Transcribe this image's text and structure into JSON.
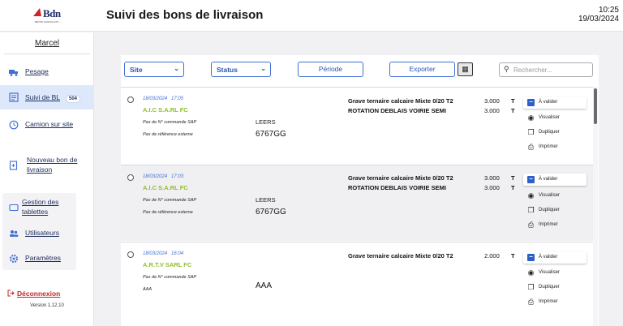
{
  "header": {
    "logo_text": "Bdn",
    "logo_tagline": "BÉTON GRANULATS ...",
    "title": "Suivi des bons de livraison",
    "time": "10:25",
    "date": "19/03/2024"
  },
  "sidebar": {
    "user": "Marcel",
    "items": [
      {
        "label": "Pesage",
        "icon": "truck-icon"
      },
      {
        "label": "Suivi de BL",
        "icon": "list-icon",
        "badge": "504"
      },
      {
        "label": "Camion sur site",
        "icon": "clock-icon"
      },
      {
        "label": "Nouveau bon de livraison",
        "label_line1": "Nouveau bon de",
        "label_line2": "livraison",
        "icon": "new-document-icon"
      }
    ],
    "admin_items": [
      {
        "label": "Gestion des tablettes",
        "label_line1": "Gestion des",
        "label_line2": "tablettes",
        "icon": "tablet-icon"
      },
      {
        "label": "Utilisateurs",
        "icon": "users-icon"
      },
      {
        "label": "Paramètres",
        "icon": "gear-icon"
      }
    ],
    "logout": "Déconnexion",
    "version": "Version 1.12.10"
  },
  "toolbar": {
    "site": "Site",
    "status": "Status",
    "periode": "Période",
    "export": "Exporter",
    "search_placeholder": "Rechercher..."
  },
  "rows": [
    {
      "date": "18/03/2024",
      "time": "17:05",
      "client": "A.I.C S.A.RL FC",
      "commande": "Pas de N° commande SAP",
      "reference": "Pas de référence externe",
      "site": "LEERS",
      "plate": "6767GG",
      "products": [
        {
          "name": "Grave ternaire calcaire Mixte 0/20 T2",
          "qty": "3.000",
          "unit": "T"
        },
        {
          "name": "ROTATION DEBLAIS VOIRIE SEMI",
          "qty": "3.000",
          "unit": "T"
        }
      ],
      "status": "À valider"
    },
    {
      "date": "18/03/2024",
      "time": "17:03",
      "client": "A.I.C S.A.RL FC",
      "commande": "Pas de N° commande SAP",
      "reference": "Pas de référence externe",
      "site": "LEERS",
      "plate": "6767GG",
      "products": [
        {
          "name": "Grave ternaire calcaire Mixte 0/20 T2",
          "qty": "3.000",
          "unit": "T"
        },
        {
          "name": "ROTATION DEBLAIS VOIRIE SEMI",
          "qty": "3.000",
          "unit": "T"
        }
      ],
      "status": "À valider"
    },
    {
      "date": "18/03/2024",
      "time": "16:04",
      "client": "A.R.T.V SARL FC",
      "commande": "Pas de N° commande SAP",
      "reference": "AAA",
      "site": "",
      "plate": "AAA",
      "products": [
        {
          "name": "Grave ternaire calcaire Mixte 0/20 T2",
          "qty": "2.000",
          "unit": "T"
        }
      ],
      "status": "À valider"
    }
  ],
  "actions": {
    "visualiser": "Visualiser",
    "dupliquer": "Dupliquer",
    "imprimer": "Imprimer"
  },
  "colors": {
    "accent": "#3f6fd6",
    "client_green": "#8fbf2a",
    "logout_red": "#c0262a",
    "status_blue": "#2c5fc9"
  }
}
